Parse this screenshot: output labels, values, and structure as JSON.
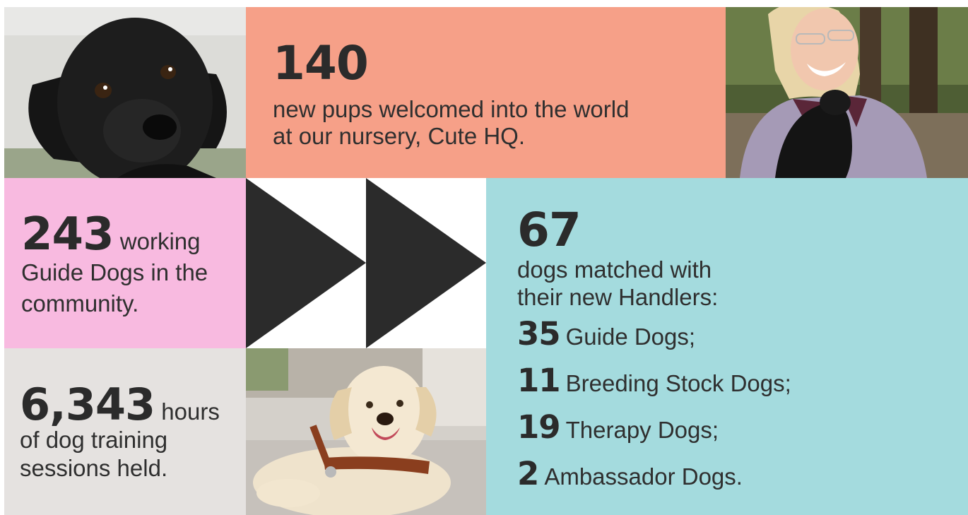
{
  "colors": {
    "salmon": "#f6a088",
    "pink": "#f8bae0",
    "gray": "#e5e2e0",
    "teal": "#a4dbde",
    "dark": "#2b2b2b"
  },
  "tiles": {
    "pups": {
      "number": "140",
      "text_line1": "new pups welcomed into the world",
      "text_line2": "at our nursery, Cute HQ."
    },
    "working": {
      "number": "243",
      "text_a": "working",
      "text_b": "Guide Dogs in the community."
    },
    "hours": {
      "number": "6,343",
      "text_a": "hours",
      "text_b": "of dog training sessions held."
    },
    "matched": {
      "number": "67",
      "lead_line1": "dogs matched with",
      "lead_line2": "their new Handlers:",
      "items": [
        {
          "number": "35",
          "label": "Guide Dogs;"
        },
        {
          "number": "11",
          "label": "Breeding Stock Dogs;"
        },
        {
          "number": "19",
          "label": "Therapy Dogs;"
        },
        {
          "number": "2",
          "label": "Ambassador Dogs."
        }
      ]
    }
  },
  "icons": {
    "arrows": "fast-forward-arrows-icon"
  }
}
